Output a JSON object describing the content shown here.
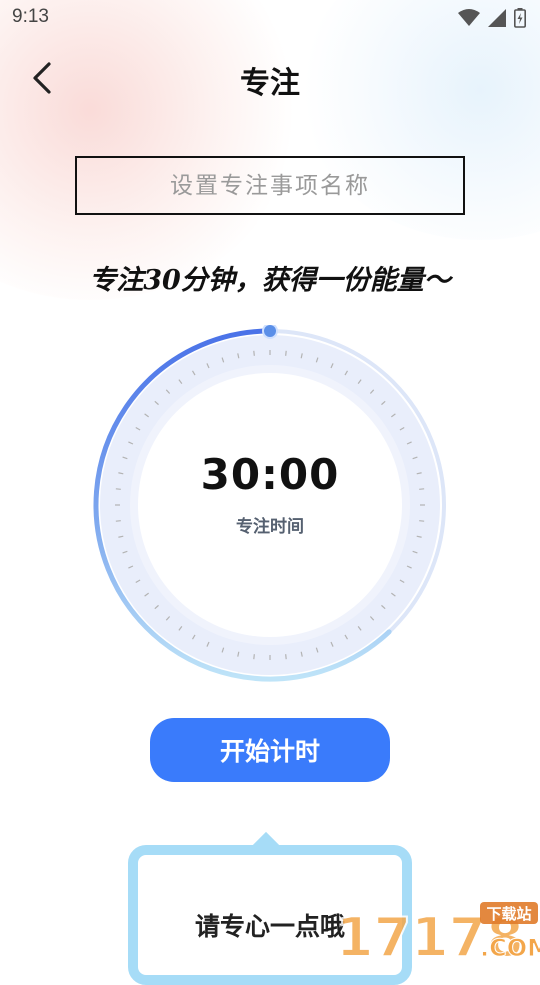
{
  "status_bar": {
    "time": "9:13",
    "icons": [
      "wifi-icon",
      "signal-icon",
      "battery-icon"
    ]
  },
  "header": {
    "title": "专注",
    "back_icon": "chevron-left-icon"
  },
  "name_input": {
    "placeholder": "设置专注事项名称",
    "value": ""
  },
  "slogan": "专注30分钟，获得一份能量～",
  "timer": {
    "display": "30:00",
    "label": "专注时间",
    "progress_fraction": 0.62
  },
  "start_button": {
    "label": "开始计时"
  },
  "tip_card": {
    "text": "请专心一点哦"
  },
  "watermark": {
    "number": "17178",
    "tag": "下载站",
    "suffix": ".COM"
  },
  "colors": {
    "accent": "#3a7bfb",
    "ring_light": "#a6dcf7",
    "ring_dark": "#4a72e8",
    "tip_border": "#a6dcf7"
  }
}
